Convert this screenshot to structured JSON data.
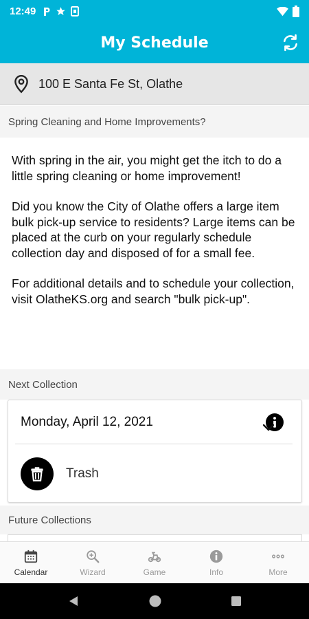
{
  "status_bar": {
    "time": "12:49",
    "left_icons": [
      "parking-icon",
      "star-icon",
      "sim-icon"
    ],
    "right_icons": [
      "wifi-icon",
      "battery-icon"
    ]
  },
  "app_bar": {
    "title": "My Schedule",
    "action_icon": "refresh-icon",
    "color": "#00b4d8"
  },
  "address": {
    "icon": "location-pin-icon",
    "text": "100 E Santa Fe St, Olathe"
  },
  "news": {
    "heading": "Spring Cleaning and Home Improvements?",
    "paragraphs": [
      "With spring in the air, you might get the itch to do a little spring cleaning or home improvement!",
      "Did you know the City of Olathe offers a large item bulk pick-up service to residents? Large items can be placed at the curb on your regularly schedule collection day and disposed of for a small fee.",
      "For additional details and to schedule your collection, visit OlatheKS.org and search \"bulk pick-up\"."
    ]
  },
  "next_collection": {
    "label": "Next Collection",
    "date": "Monday, April 12, 2021",
    "info_icon": "info-icon",
    "item": {
      "icon": "trash-bin-icon",
      "label": "Trash",
      "expand_icon": "chevron-down-icon"
    }
  },
  "future_collections": {
    "label": "Future Collections"
  },
  "bottom_nav": {
    "items": [
      {
        "label": "Calendar",
        "icon": "calendar-icon",
        "active": true
      },
      {
        "label": "Wizard",
        "icon": "wizard-search-icon",
        "active": false
      },
      {
        "label": "Game",
        "icon": "game-icon",
        "active": false
      },
      {
        "label": "Info",
        "icon": "info-icon",
        "active": false
      },
      {
        "label": "More",
        "icon": "more-icon",
        "active": false
      }
    ]
  },
  "system_nav": [
    "back-icon",
    "home-icon",
    "recents-icon"
  ]
}
